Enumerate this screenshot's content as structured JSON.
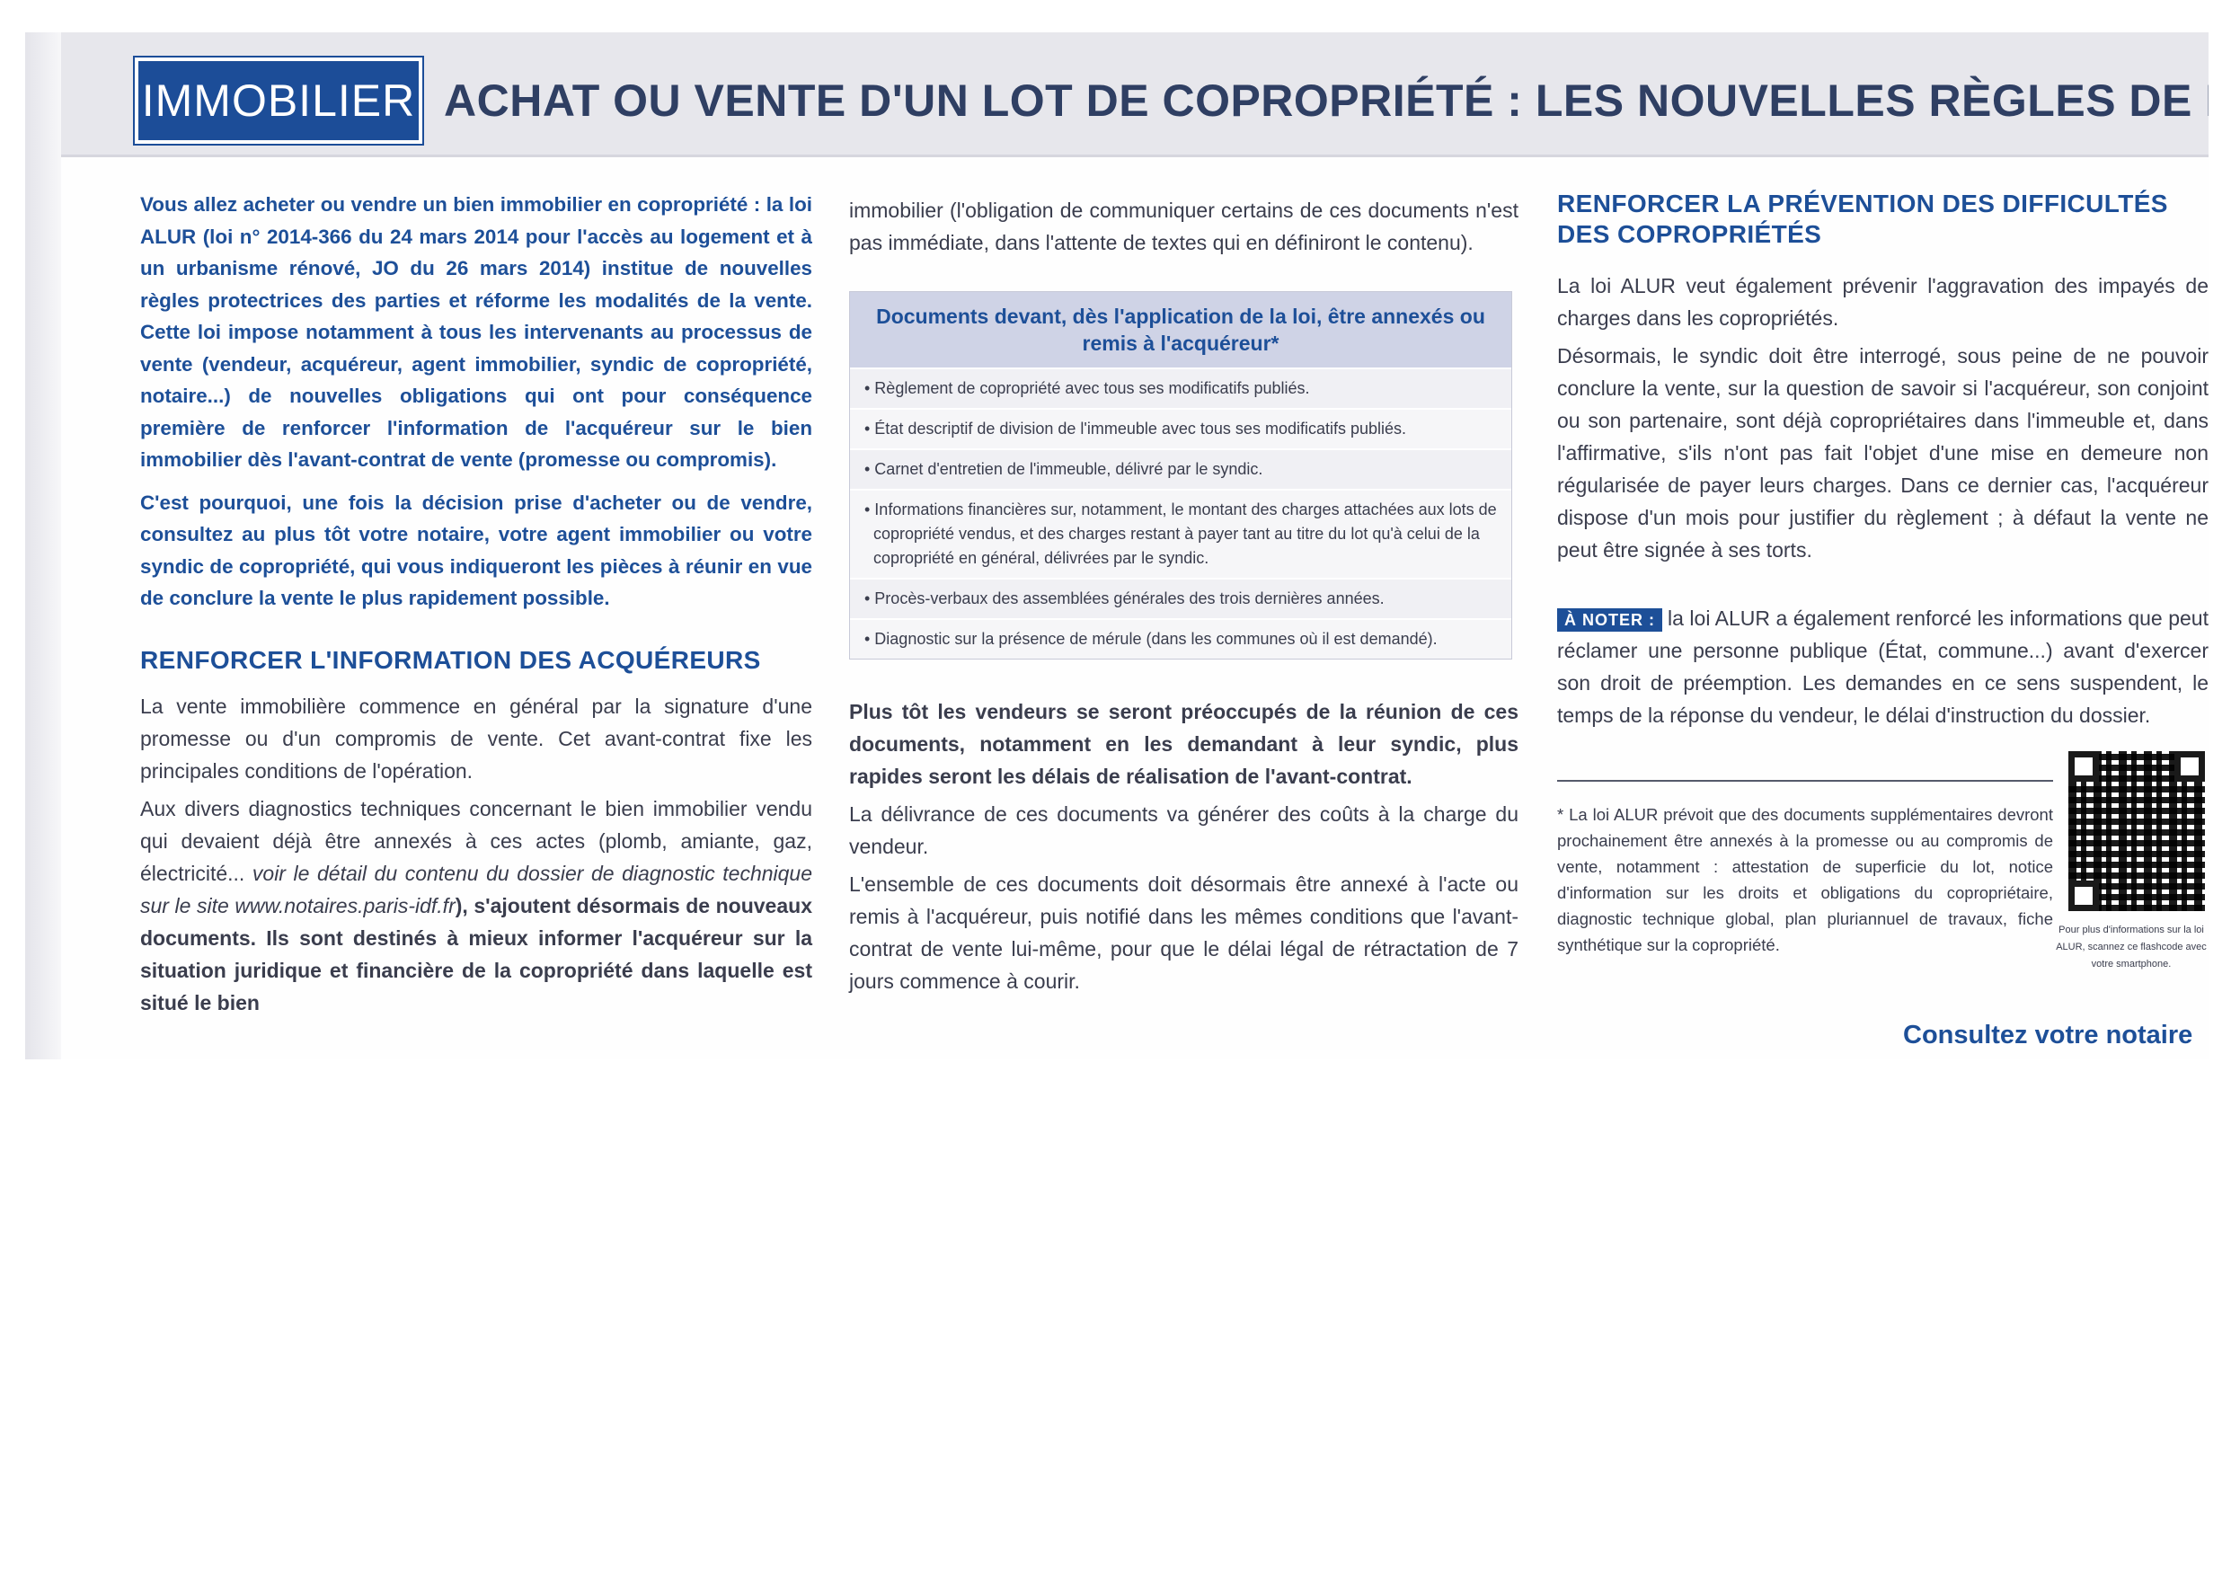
{
  "header": {
    "section_badge": "IMMOBILIER",
    "headline": "ACHAT OU VENTE D'UN LOT DE COPROPRIÉTÉ : LES NOUVELLES RÈGLES DE LA LOI ALUR"
  },
  "column1": {
    "intro_paragraph_1": "Vous allez acheter ou vendre un bien immobilier en copropriété : la loi ALUR (loi n° 2014-366 du 24 mars 2014 pour l'accès au logement et à un urbanisme rénové, JO du 26 mars 2014) institue de nouvelles règles protectrices des parties et réforme les modalités de la vente. Cette loi impose notamment à tous les intervenants au processus de vente (vendeur, acquéreur, agent immobilier, syndic de copropriété, notaire...) de nouvelles obligations qui ont pour conséquence première de renforcer l'information de l'acquéreur sur le bien immobilier dès l'avant-contrat de vente (promesse ou compromis).",
    "intro_paragraph_2": "C'est pourquoi, une fois la décision prise d'acheter ou de vendre, consultez au plus tôt votre notaire, votre agent immobilier ou votre syndic de copropriété, qui vous indiqueront les pièces à réunir en vue de conclure la vente le plus rapidement possible.",
    "section_heading": "RENFORCER L'INFORMATION DES ACQUÉREURS",
    "body_paragraph_1": "La vente immobilière commence en général par la signature d'une promesse ou d'un compromis de vente. Cet avant-contrat fixe les principales conditions de l'opération.",
    "body_paragraph_2_start": "Aux divers diagnostics techniques concernant le bien immobilier vendu qui devaient déjà être annexés à ces actes (plomb, amiante, gaz, électricité...",
    "body_paragraph_2_link": "voir le détail du contenu du dossier de diagnostic technique sur le site www.notaires.paris-idf.fr",
    "body_paragraph_2_end": "), s'ajoutent désormais de nouveaux documents. Ils sont destinés à mieux informer l'acquéreur sur la situation juridique et financière de la copropriété dans laquelle est situé le bien"
  },
  "column2": {
    "continuation": "immobilier (l'obligation de communiquer certains de ces documents n'est pas immédiate, dans l'attente de textes qui en définiront le contenu).",
    "documents_box": {
      "title": "Documents devant, dès l'application de la loi, être annexés ou remis à l'acquéreur*",
      "items": [
        "• Règlement de copropriété avec tous ses modificatifs publiés.",
        "• État descriptif de division de l'immeuble avec tous ses modificatifs publiés.",
        "• Carnet d'entretien de l'immeuble, délivré par le syndic.",
        "• Informations financières sur, notamment, le montant des charges attachées aux lots de copropriété vendus, et des charges restant à payer tant au titre du lot qu'à celui de la copropriété en général, délivrées par le syndic.",
        "• Procès-verbaux des assemblées générales des trois dernières années.",
        "• Diagnostic sur la présence de mérule (dans les communes où il est demandé)."
      ]
    },
    "bold_paragraph": "Plus tôt les vendeurs se seront préoccupés de la réunion de ces documents, notamment en les demandant à leur syndic, plus rapides seront les délais de réalisation de l'avant-contrat.",
    "paragraph_costs": "La délivrance de ces documents va générer des coûts à la charge du vendeur.",
    "paragraph_annex": "L'ensemble de ces documents doit désormais être annexé à l'acte ou remis à l'acquéreur, puis notifié dans les mêmes conditions que l'avant-contrat de vente lui-même, pour que le délai légal de rétractation de 7 jours commence à courir."
  },
  "column3": {
    "section_heading": "RENFORCER LA PRÉVENTION DES DIFFICULTÉS DES COPROPRIÉTÉS",
    "paragraph_1": "La loi ALUR veut également prévenir l'aggravation des impayés de charges dans les copropriétés.",
    "paragraph_2": "Désormais, le syndic doit être interrogé, sous peine de ne pouvoir conclure la vente, sur la question de savoir si l'acquéreur, son conjoint ou son partenaire, sont déjà copropriétaires dans l'immeuble et, dans l'affirmative, s'ils n'ont pas fait l'objet d'une mise en demeure non régularisée de payer leurs charges. Dans ce dernier cas, l'acquéreur dispose d'un mois pour justifier du règlement ; à défaut la vente ne peut être signée à ses torts.",
    "notice_tag": "À NOTER :",
    "notice_text": "la loi ALUR a également renforcé les informations que peut réclamer une personne publique (État, commune...) avant d'exercer son droit de préemption. Les demandes en ce sens suspendent, le temps de la réponse du vendeur, le délai d'instruction du dossier.",
    "footnote": "* La loi ALUR prévoit que des documents supplémentaires devront prochainement être annexés à la promesse ou au compromis de vente, notamment : attestation de superficie du lot, notice d'information sur les droits et obligations du copropriétaire, diagnostic technique global, plan pluriannuel de travaux, fiche synthétique sur la copropriété.",
    "qr_caption": "Pour plus d'informations sur la loi ALUR, scannez ce flashcode avec votre smartphone.",
    "closing_call": "Consultez votre notaire"
  }
}
